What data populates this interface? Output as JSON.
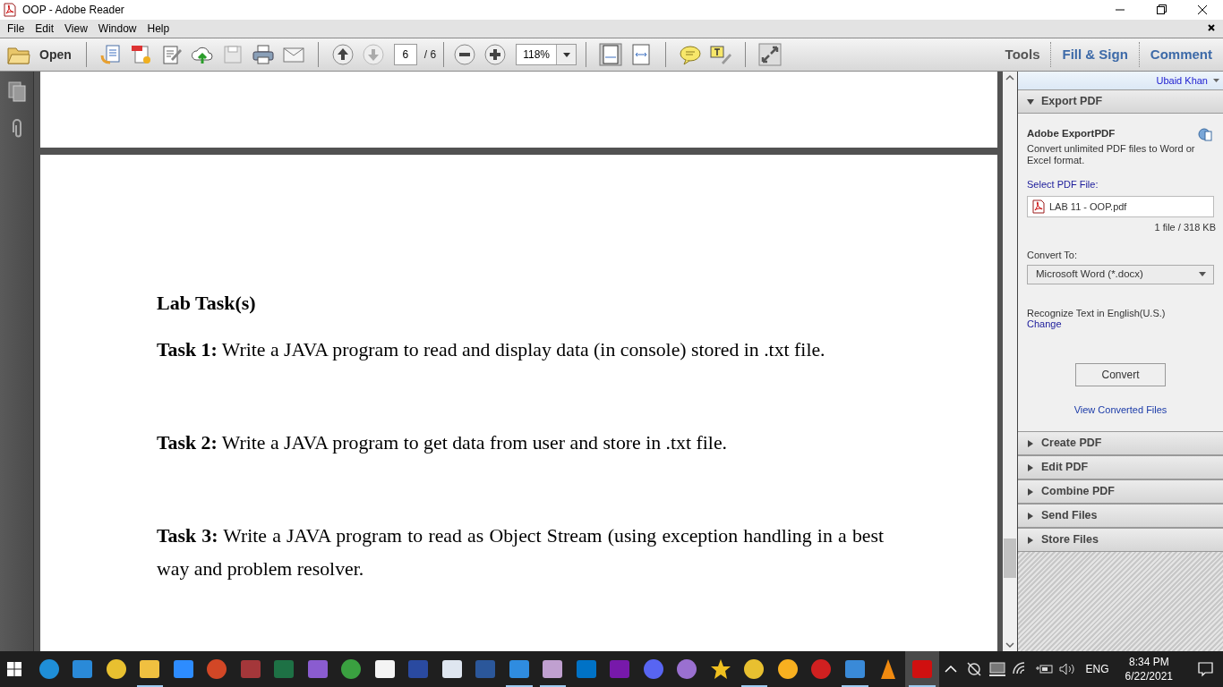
{
  "window": {
    "title": "OOP - Adobe Reader"
  },
  "menu": [
    "File",
    "Edit",
    "View",
    "Window",
    "Help"
  ],
  "toolbar": {
    "open_label": "Open",
    "page": "6",
    "page_total": "/ 6",
    "zoom": "118%",
    "tabs": [
      {
        "label": "Tools",
        "kind": "plain"
      },
      {
        "label": "Fill & Sign",
        "kind": "link"
      },
      {
        "label": "Comment",
        "kind": "link"
      }
    ]
  },
  "document": {
    "heading": "Lab Task(s)",
    "paragraphs": [
      "**Task 1:** Write a JAVA program to read and display data (in console) stored in .txt file.",
      "**Task 2:** Write a JAVA program to get data from user and store in .txt file.",
      "**Task 3:** Write a JAVA program to read as Object Stream (using exception handling in a best way and problem resolver."
    ]
  },
  "side_panel": {
    "user": "Ubaid Khan",
    "export": {
      "title": "Export PDF",
      "expanded": true,
      "service": "Adobe ExportPDF",
      "description": "Convert unlimited PDF files to Word or Excel format.",
      "select_label": "Select PDF File:",
      "file": "LAB 11 - OOP.pdf",
      "file_info": "1 file / 318 KB",
      "convert_to_label": "Convert To:",
      "format": "Microsoft Word (*.docx)",
      "recognize": "Recognize Text in English(U.S.)",
      "change_link": "Change",
      "convert_button": "Convert",
      "view_link": "View Converted Files"
    },
    "sections": [
      {
        "title": "Create PDF",
        "expanded": false
      },
      {
        "title": "Edit PDF",
        "expanded": false
      },
      {
        "title": "Combine PDF",
        "expanded": false
      },
      {
        "title": "Send Files",
        "expanded": false
      },
      {
        "title": "Store Files",
        "expanded": false
      }
    ]
  },
  "taskbar": {
    "apps": [
      {
        "running": false,
        "active": false
      },
      {
        "running": false,
        "active": false
      },
      {
        "running": false,
        "active": false
      },
      {
        "running": true,
        "active": false
      },
      {
        "running": false,
        "active": false
      },
      {
        "running": false,
        "active": false
      },
      {
        "running": false,
        "active": false
      },
      {
        "running": false,
        "active": false
      },
      {
        "running": false,
        "active": false
      },
      {
        "running": false,
        "active": false
      },
      {
        "running": false,
        "active": false
      },
      {
        "running": false,
        "active": false
      },
      {
        "running": false,
        "active": false
      },
      {
        "running": false,
        "active": false
      },
      {
        "running": true,
        "active": false
      },
      {
        "running": true,
        "active": false
      },
      {
        "running": false,
        "active": false
      },
      {
        "running": false,
        "active": false
      },
      {
        "running": false,
        "active": false
      },
      {
        "running": false,
        "active": false
      },
      {
        "running": false,
        "active": false
      },
      {
        "running": true,
        "active": false
      },
      {
        "running": false,
        "active": false
      },
      {
        "running": false,
        "active": false
      },
      {
        "running": true,
        "active": false
      },
      {
        "running": false,
        "active": false
      },
      {
        "running": true,
        "active": true
      }
    ],
    "language": "ENG",
    "time": "8:34 PM",
    "date": "6/22/2021"
  }
}
